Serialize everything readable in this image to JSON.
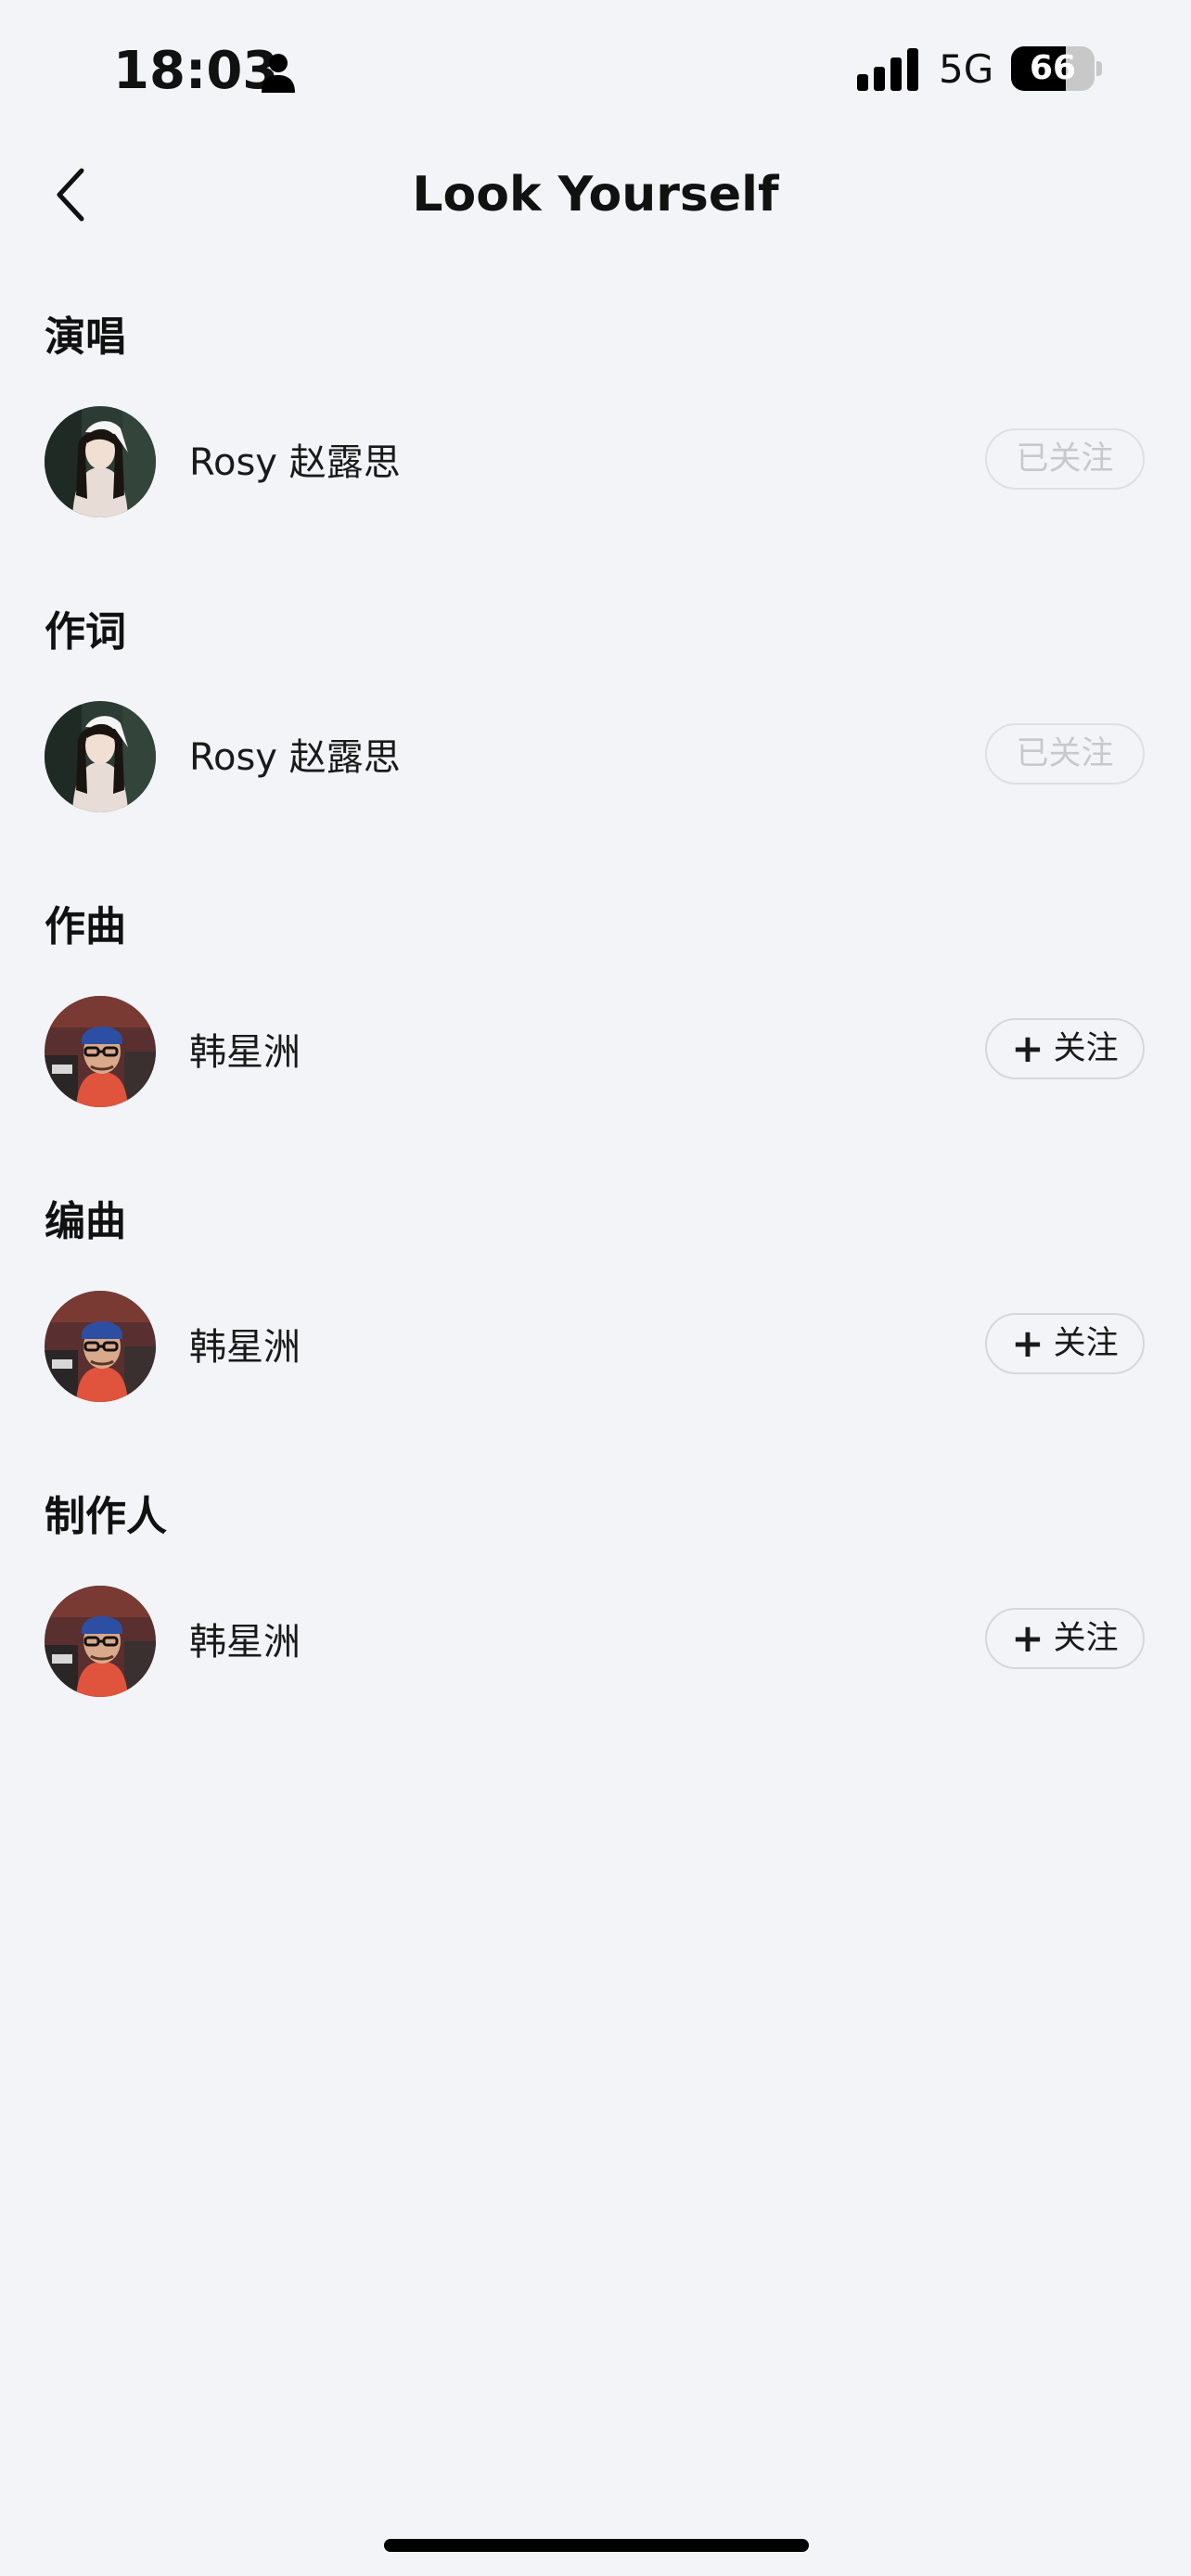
{
  "status_bar": {
    "time": "18:03",
    "network": "5G",
    "battery": "66",
    "battery_level_percent": 66
  },
  "nav": {
    "title": "Look Yourself"
  },
  "credits": [
    {
      "role": "演唱",
      "name": "Rosy 赵露思",
      "avatar": "female-singer-avatar",
      "follow_state": "followed",
      "follow_label": "已关注"
    },
    {
      "role": "作词",
      "name": "Rosy 赵露思",
      "avatar": "female-singer-avatar",
      "follow_state": "followed",
      "follow_label": "已关注"
    },
    {
      "role": "作曲",
      "name": "韩星洲",
      "avatar": "male-producer-avatar",
      "follow_state": "unfollowed",
      "follow_label": "关注"
    },
    {
      "role": "编曲",
      "name": "韩星洲",
      "avatar": "male-producer-avatar",
      "follow_state": "unfollowed",
      "follow_label": "关注"
    },
    {
      "role": "制作人",
      "name": "韩星洲",
      "avatar": "male-producer-avatar",
      "follow_state": "unfollowed",
      "follow_label": "关注"
    }
  ]
}
